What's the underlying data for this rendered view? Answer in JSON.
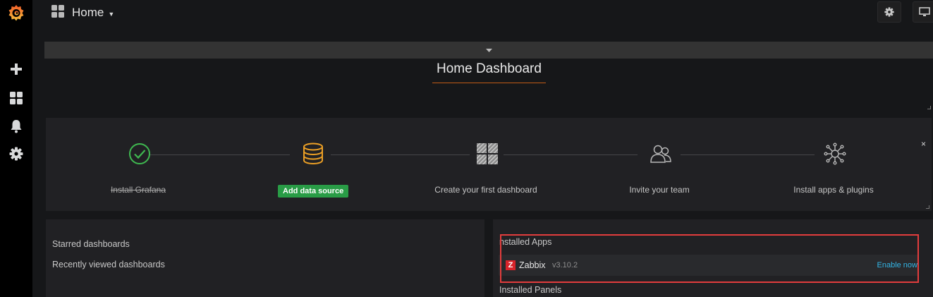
{
  "sidebar": {
    "items": [
      "grafana-logo",
      "create",
      "dashboards",
      "alerting",
      "configuration"
    ]
  },
  "navbar": {
    "title": "Home"
  },
  "dashboard": {
    "title": "Home Dashboard"
  },
  "getting_started": {
    "steps": [
      {
        "label": "Install Grafana",
        "status": "done",
        "icon": "check-circle-icon"
      },
      {
        "label": "Add data source",
        "status": "active",
        "icon": "database-icon"
      },
      {
        "label": "Create your first dashboard",
        "status": "todo",
        "icon": "dashboard-grid-icon"
      },
      {
        "label": "Invite your team",
        "status": "todo",
        "icon": "users-icon"
      },
      {
        "label": "Install apps & plugins",
        "status": "todo",
        "icon": "plugins-icon"
      }
    ],
    "close_label": "×"
  },
  "dashlist": {
    "starred": "Starred dashboards",
    "recent": "Recently viewed dashboards"
  },
  "plugins": {
    "installed_apps_heading": "nstalled Apps",
    "installed_panels_heading": "Installed Panels",
    "apps": [
      {
        "logo": "Z",
        "name": "Zabbix",
        "version": "v3.10.2",
        "action": "Enable now"
      }
    ]
  },
  "colors": {
    "accent_orange": "#c15c17",
    "success_green": "#299c46",
    "link_blue": "#33b5e5",
    "highlight_red": "#e23d3d"
  }
}
